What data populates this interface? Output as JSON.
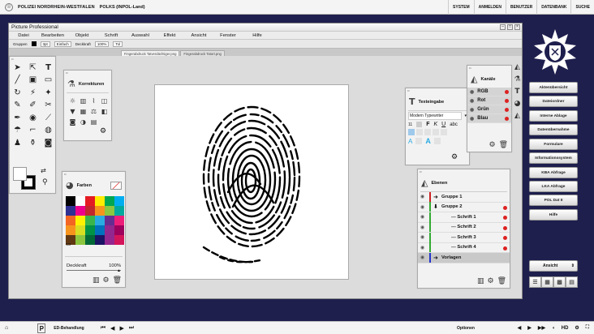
{
  "topbar": {
    "org": "POLIZEI NORDRHEIN-WESTFALEN",
    "system": "POLKS (INPOL-Land)",
    "nav": [
      "SYSTEM",
      "ANMELDEN",
      "BENUTZER",
      "DATENBANK",
      "SUCHE"
    ]
  },
  "window": {
    "title": "Picture Professional",
    "menu": [
      "Datei",
      "Bearbeiten",
      "Objekt",
      "Schrift",
      "Auswahl",
      "Effekt",
      "Ansicht",
      "Fenster",
      "Hilfe"
    ],
    "options": {
      "group": "Gruppen",
      "size": "3pt",
      "mode": "Einfach",
      "opacity_label": "Deckkraft",
      "opacity": "100%",
      "extra": "Tol"
    },
    "tabs": [
      "Fingerabdruck Tatverdächtiger.png",
      "Fingerabdruck Tatort.png"
    ]
  },
  "panels": {
    "korrekturen": {
      "title": "Korrekturen"
    },
    "farben": {
      "title": "Farben",
      "opacity_label": "Deckkraft",
      "opacity_value": "100%",
      "swatches": [
        "#000000",
        "#ffffff",
        "#e51b23",
        "#ffed00",
        "#00a651",
        "#00aeef",
        "#2e3192",
        "#ec008c",
        "#c1272d",
        "#f7941d",
        "#8dc63f",
        "#00a99d",
        "#f26522",
        "#fff200",
        "#39b54a",
        "#29abe2",
        "#662d91",
        "#ed1e79",
        "#f7941d",
        "#d7df23",
        "#009245",
        "#0071bc",
        "#92278f",
        "#9e005d",
        "#603813",
        "#8cc63f",
        "#006837",
        "#1b1464",
        "#93278f",
        "#d4145a"
      ]
    },
    "texteingabe": {
      "title": "Texteingabe",
      "font": "Modern Typewriter",
      "size": "11",
      "styles": [
        "F",
        "K",
        "U",
        "abc"
      ]
    },
    "ebenen": {
      "title": "Ebenen",
      "layers": [
        {
          "name": "Gruppe 1",
          "color": "#cc2222",
          "indent": 0,
          "dot": false,
          "grey": false
        },
        {
          "name": "Gruppe 2",
          "color": "#33aa33",
          "indent": 0,
          "dot": true,
          "grey": false
        },
        {
          "name": "--- Schrift 1",
          "color": "#33aa33",
          "indent": 1,
          "dot": true,
          "grey": false
        },
        {
          "name": "--- Schrift 2",
          "color": "#33aa33",
          "indent": 1,
          "dot": true,
          "grey": false
        },
        {
          "name": "--- Schrift 3",
          "color": "#33aa33",
          "indent": 1,
          "dot": true,
          "grey": false
        },
        {
          "name": "--- Schrift 4",
          "color": "#33aa33",
          "indent": 1,
          "dot": true,
          "grey": false
        },
        {
          "name": "Vorlagen",
          "color": "#2233cc",
          "indent": 0,
          "dot": false,
          "grey": true
        }
      ]
    },
    "kanaele": {
      "title": "Kanäle",
      "channels": [
        "RGB",
        "Rot",
        "Grün",
        "Blau"
      ]
    }
  },
  "sidebar": {
    "buttons": [
      "Aktenübersicht",
      "Dateiordner",
      "Interne Ablage",
      "Datenübernahme",
      "Formulare",
      "Informationssystem",
      "KBA Abfrage",
      "LKA Abfrage",
      "POL Dat II",
      "Hilfe"
    ],
    "ansicht": "Ansicht"
  },
  "bottombar": {
    "task": "ED-Behandlung",
    "options": "Optionen",
    "hd": "HD"
  }
}
